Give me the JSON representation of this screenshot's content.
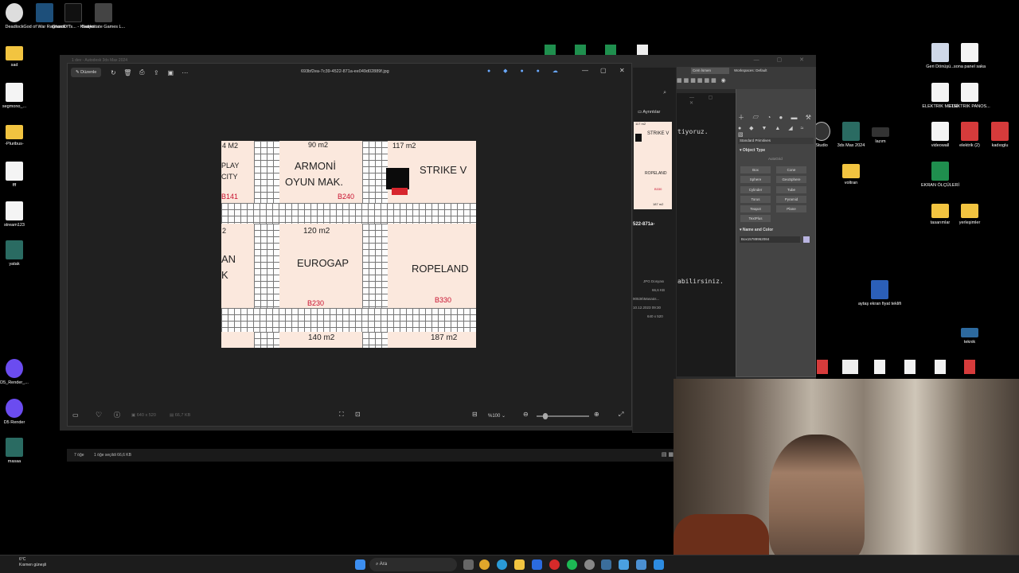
{
  "desktop": {
    "icons_left": [
      {
        "label": "Deadlock",
        "icon": "deadlock-app-icon"
      },
      {
        "label": "God of War Ragnarok",
        "icon": "game-icon"
      },
      {
        "label": "GhostOfTs... - Kısayol",
        "icon": "game-icon"
      },
      {
        "label": "Battlestate Games L...",
        "icon": "game-icon"
      },
      {
        "label": "sad",
        "icon": "folder-icon"
      },
      {
        "label": "segmono_...",
        "icon": "file-icon"
      },
      {
        "label": "-Pluribus-",
        "icon": "folder-icon"
      },
      {
        "label": "fff",
        "icon": "file-icon"
      },
      {
        "label": "stream123",
        "icon": "file-icon"
      },
      {
        "label": "yatak",
        "icon": "3dsmax-icon"
      },
      {
        "label": "D5_Render_...",
        "icon": "d5-render-icon"
      },
      {
        "label": "D5 Render",
        "icon": "d5-render-icon"
      },
      {
        "label": "masaa",
        "icon": "3dsmax-icon"
      }
    ],
    "icons_right": [
      {
        "label": "Geri Dönüşü...",
        "icon": "recycle-bin-icon"
      },
      {
        "label": "sona panel saka",
        "icon": "file-icon"
      },
      {
        "label": "ELEKTRIK METNİ",
        "icon": "file-icon"
      },
      {
        "label": "ELEKTRIK PANOS...",
        "icon": "file-icon"
      },
      {
        "label": "videowall",
        "icon": "file-icon"
      },
      {
        "label": "elektrik (2)",
        "icon": "pdf-icon"
      },
      {
        "label": "kadıoglu",
        "icon": "pdf-icon"
      },
      {
        "label": "EKRAN ÖLÇÜLERİ",
        "icon": "excel-icon"
      },
      {
        "label": "tasarımlar",
        "icon": "folder-icon"
      },
      {
        "label": "yerleşimler",
        "icon": "folder-icon"
      },
      {
        "label": "aytaş ekran fiyat teklifi",
        "icon": "word-icon"
      },
      {
        "label": "teknik",
        "icon": "file-icon"
      }
    ],
    "icons_mid": [
      {
        "label": "Studio",
        "icon": "app-icon"
      },
      {
        "label": "3ds Max 2024",
        "icon": "3dsmax-icon"
      },
      {
        "label": "lazım",
        "icon": "file-icon"
      },
      {
        "label": "voltran",
        "icon": "folder-icon"
      }
    ]
  },
  "viewer": {
    "filename": "693bf2ea-7c39-4522-871a-ee049d02889f.jpg",
    "edit_label": "Düzenle",
    "dimensions": "640 x 520",
    "filesize": "66,7 KB",
    "zoom": "%100",
    "behind_title": "1 dev - Autodesk 3ds Max 2024"
  },
  "floorplan": {
    "top_areas": [
      "4 M2",
      "90 m2",
      "117 m2"
    ],
    "left_partial": [
      "PLAY",
      "CITY",
      "B141"
    ],
    "armoni": [
      "ARMONİ",
      "OYUN MAK."
    ],
    "armoni_code": "B240",
    "strike": "STRIKE V",
    "mid_areas": [
      "2",
      "120 m2"
    ],
    "left_partial2": [
      "AN",
      "K"
    ],
    "eurogap": "EUROGAP",
    "eurogap_code": "B230",
    "ropeland": "ROPELAND",
    "ropeland_code": "B330",
    "bottom_areas": [
      "140 m2",
      "187 m2"
    ]
  },
  "explorer": {
    "details_label": "Ayrıntılar",
    "text1": "tiyoruz.",
    "text2": "abilirsiniz.",
    "file_frag": "522-871a-",
    "type": "JPG Dosyası",
    "size": "66,6 KB",
    "path": "90536\\Masaüs...",
    "date": "10.12.2023 09:30",
    "dims": "640 x 520",
    "thumb_texts": [
      "STRIKE V",
      "ROPELAND",
      "B330",
      "187 m2",
      "117 m2"
    ],
    "status_count": "7 öğe",
    "status_selected": "1 öğe seçildi  66,6 KB"
  },
  "max": {
    "signin": "Cem İsmen",
    "workspaces_label": "Workspaces:",
    "workspace": "Default",
    "dropdown": "Standard Primitives",
    "object_type": "Object Type",
    "autogrid": "AutoGrid",
    "buttons": [
      "Box",
      "Cone",
      "Sphere",
      "GeoSphere",
      "Cylinder",
      "Tube",
      "Torus",
      "Pyramid",
      "Teapot",
      "Plane",
      "TextPlus"
    ],
    "name_color": "Name and Color",
    "object_name": "Box15789962084"
  },
  "taskbar": {
    "weather_temp": "6°C",
    "weather_desc": "Kısmen güneşli",
    "search": "Ara"
  }
}
